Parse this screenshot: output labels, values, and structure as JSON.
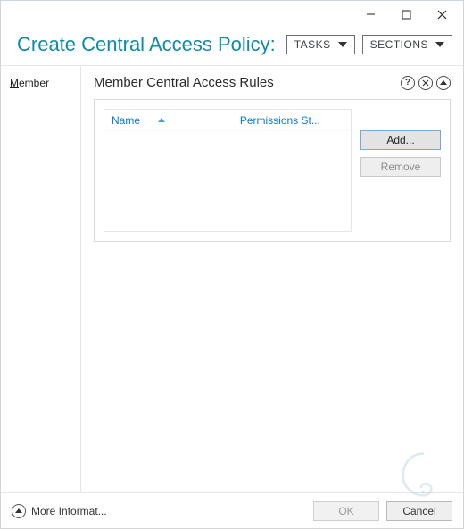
{
  "window": {
    "title": "Create Central Access Policy:"
  },
  "header": {
    "tasks_label": "TASKS",
    "sections_label": "SECTIONS"
  },
  "sidebar": {
    "items": [
      {
        "label": "Member",
        "accel_index": 0
      }
    ]
  },
  "section": {
    "title": "Member Central Access Rules",
    "columns": {
      "name": "Name",
      "permissions": "Permissions St..."
    },
    "rows": [],
    "buttons": {
      "add": "Add...",
      "remove": "Remove"
    }
  },
  "footer": {
    "more_info": "More Informat...",
    "ok": "OK",
    "cancel": "Cancel"
  }
}
